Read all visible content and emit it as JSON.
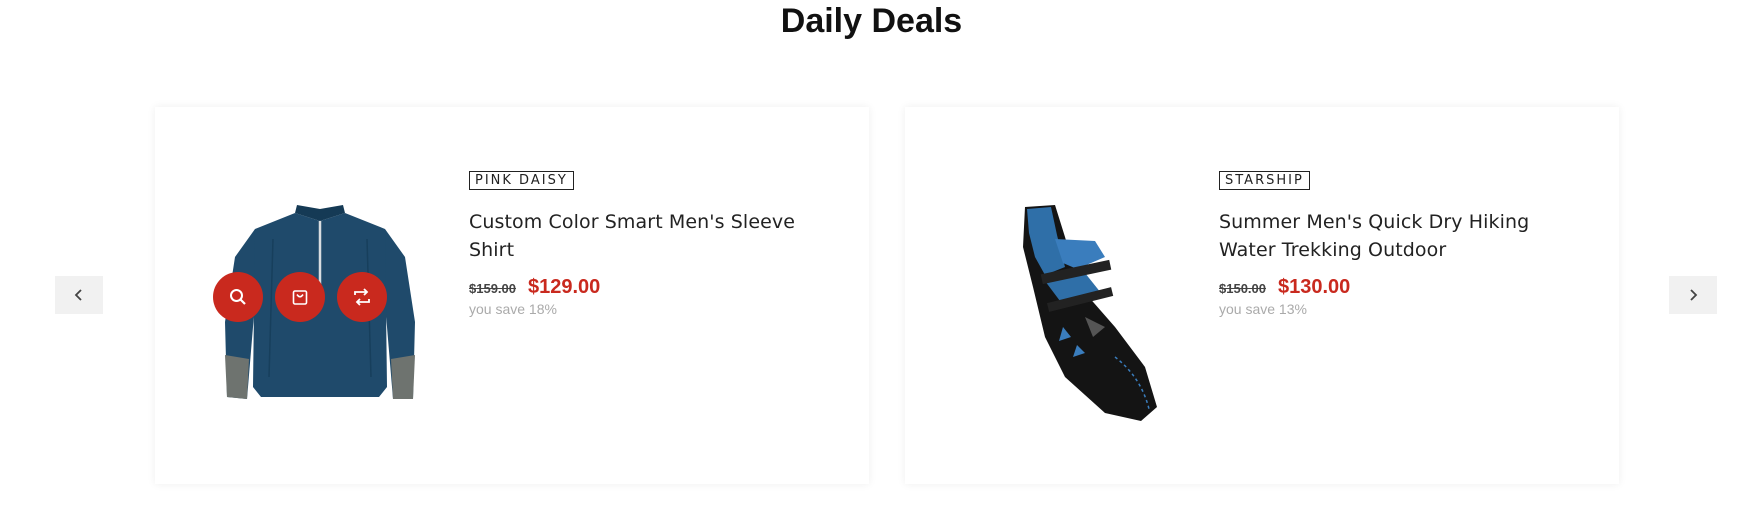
{
  "section": {
    "title": "Daily Deals"
  },
  "navigation": {
    "prev_icon": "chevron-left-icon",
    "next_icon": "chevron-right-icon"
  },
  "products": [
    {
      "brand": "PINK DAISY",
      "title": "Custom Color Smart Men's Sleeve Shirt",
      "old_price": "$159.00",
      "new_price": "$129.00",
      "save_text": "you save 18%",
      "image": "navy-quarter-zip-long-sleeve-shirt",
      "actions": [
        "search-icon",
        "shopping-bag-icon",
        "compare-arrows-icon"
      ]
    },
    {
      "brand": "STARSHIP",
      "title": "Summer Men's Quick Dry Hiking Water Trekking Outdoor",
      "old_price": "$150.00",
      "new_price": "$130.00",
      "save_text": "you save 13%",
      "image": "blue-black-climbing-shoe"
    }
  ],
  "colors": {
    "accent": "#c9291e",
    "text": "#222222",
    "muted": "#aaaaaa",
    "nav_bg": "#f1f1f1"
  }
}
